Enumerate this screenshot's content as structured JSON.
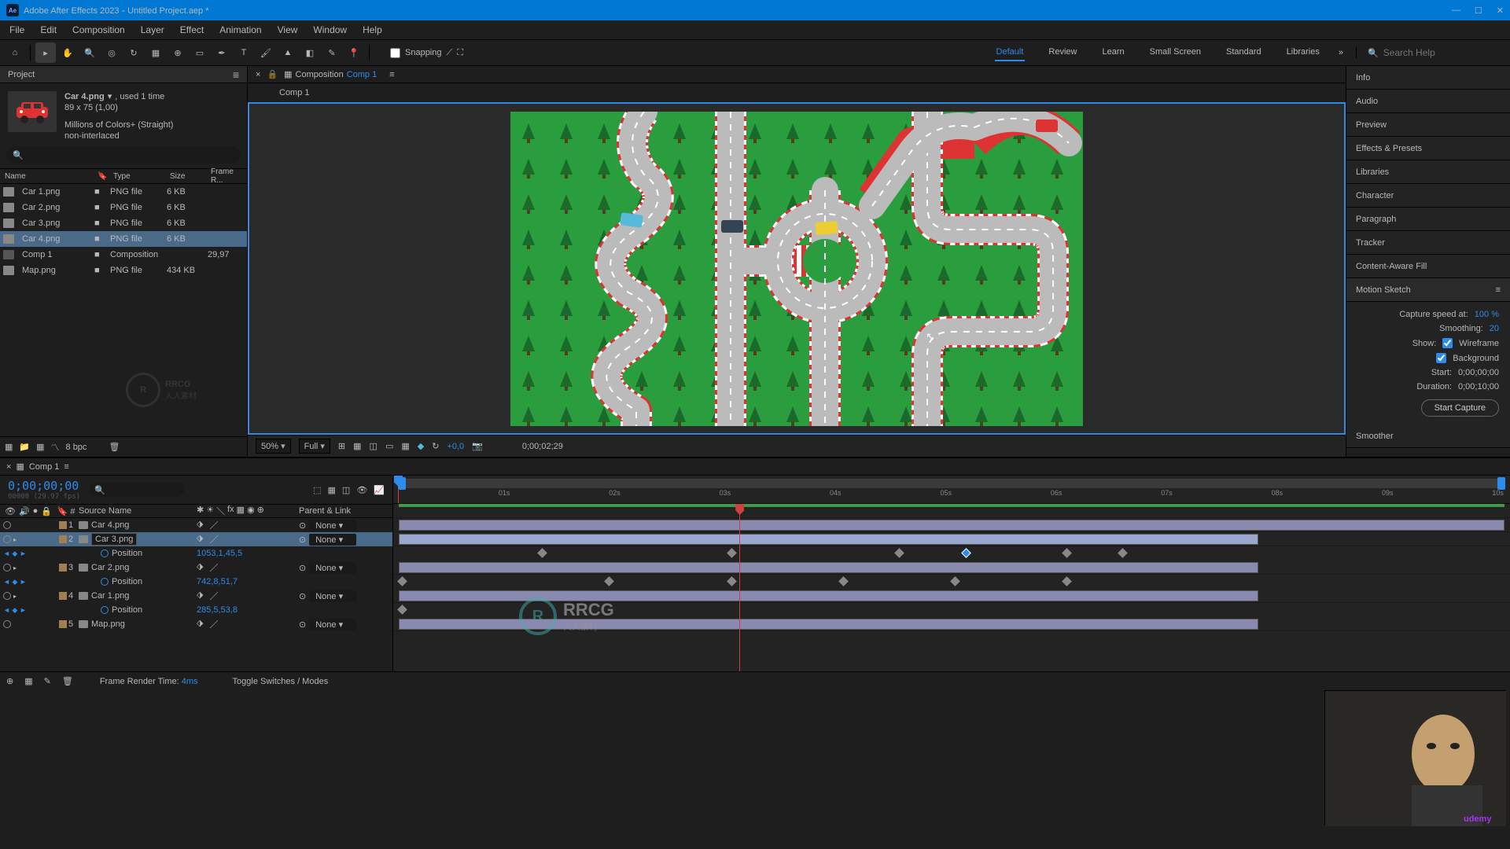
{
  "titlebar": {
    "app": "Adobe After Effects 2023",
    "file": "Untitled Project.aep *",
    "logo": "Ae"
  },
  "menu": [
    "File",
    "Edit",
    "Composition",
    "Layer",
    "Effect",
    "Animation",
    "View",
    "Window",
    "Help"
  ],
  "toolbar": {
    "snapping": "Snapping"
  },
  "workspaces": {
    "items": [
      "Default",
      "Review",
      "Learn",
      "Small Screen",
      "Standard",
      "Libraries"
    ],
    "active": 0
  },
  "search": {
    "placeholder": "Search Help"
  },
  "project": {
    "title": "Project",
    "asset": {
      "name": "Car 4.png",
      "used": ", used 1 time",
      "dims": "89 x 75 (1,00)",
      "colors": "Millions of Colors+ (Straight)",
      "interlace": "non-interlaced"
    },
    "columns": {
      "name": "Name",
      "type": "Type",
      "size": "Size",
      "fr": "Frame R..."
    },
    "rows": [
      {
        "name": "Car 1.png",
        "type": "PNG file",
        "size": "6 KB",
        "fr": "",
        "sel": false,
        "comp": false
      },
      {
        "name": "Car 2.png",
        "type": "PNG file",
        "size": "6 KB",
        "fr": "",
        "sel": false,
        "comp": false
      },
      {
        "name": "Car 3.png",
        "type": "PNG file",
        "size": "6 KB",
        "fr": "",
        "sel": false,
        "comp": false
      },
      {
        "name": "Car 4.png",
        "type": "PNG file",
        "size": "6 KB",
        "fr": "",
        "sel": true,
        "comp": false
      },
      {
        "name": "Comp 1",
        "type": "Composition",
        "size": "",
        "fr": "29,97",
        "sel": false,
        "comp": true
      },
      {
        "name": "Map.png",
        "type": "PNG file",
        "size": "434 KB",
        "fr": "",
        "sel": false,
        "comp": false
      }
    ],
    "bpc": "8 bpc"
  },
  "composition": {
    "label": "Composition",
    "name": "Comp 1",
    "tab": "Comp 1"
  },
  "viewer": {
    "zoom": "50%",
    "res": "Full",
    "exposure": "+0,0",
    "timecode": "0;00;02;29"
  },
  "right_panels": [
    "Info",
    "Audio",
    "Preview",
    "Effects & Presets",
    "Libraries",
    "Character",
    "Paragraph",
    "Tracker",
    "Content-Aware Fill"
  ],
  "motion": {
    "title": "Motion Sketch",
    "capture_label": "Capture speed at:",
    "capture_val": "100 %",
    "smoothing_label": "Smoothing:",
    "smoothing_val": "20",
    "show_label": "Show:",
    "wireframe": "Wireframe",
    "background": "Background",
    "start_label": "Start:",
    "start_val": "0;00;00;00",
    "duration_label": "Duration:",
    "duration_val": "0;00;10;00",
    "button": "Start Capture"
  },
  "smoother": {
    "title": "Smoother"
  },
  "timeline": {
    "tab": "Comp 1",
    "timecode": "0;00;00;00",
    "subtc": "00000 (29.97 fps)",
    "columns": {
      "num": "#",
      "source": "Source Name",
      "parent": "Parent & Link"
    },
    "ruler": [
      "",
      "01s",
      "02s",
      "03s",
      "04s",
      "05s",
      "06s",
      "07s",
      "08s",
      "09s",
      "10s"
    ],
    "layers": [
      {
        "n": "1",
        "name": "Car 4.png",
        "sel": false,
        "parent": "None",
        "prop": null
      },
      {
        "n": "2",
        "name": "Car 3.png",
        "sel": true,
        "parent": "None",
        "prop": {
          "name": "Position",
          "val": "1053,1,45,5"
        }
      },
      {
        "n": "3",
        "name": "Car 2.png",
        "sel": false,
        "parent": "None",
        "prop": {
          "name": "Position",
          "val": "742,8,51,7"
        }
      },
      {
        "n": "4",
        "name": "Car 1.png",
        "sel": false,
        "parent": "None",
        "prop": {
          "name": "Position",
          "val": "285,5,53,8"
        }
      },
      {
        "n": "5",
        "name": "Map.png",
        "sel": false,
        "parent": "None",
        "prop": null
      }
    ],
    "keyframes": {
      "2": [
        1.3,
        3.0,
        4.5,
        5.1,
        6.0,
        6.5
      ],
      "3": [
        0.05,
        1.9,
        3.0,
        4.0,
        5.0,
        6.0
      ],
      "4": [
        0.05
      ]
    },
    "selected_kf": {
      "layer": "2",
      "idx": 3
    },
    "playhead_pct": 31
  },
  "footer": {
    "frt_label": "Frame Render Time:",
    "frt_val": "4ms",
    "toggle": "Toggle Switches / Modes"
  },
  "watermark": {
    "logo": "R",
    "text1": "RRCG",
    "text2": "人人素材"
  },
  "udemy": "udemy"
}
